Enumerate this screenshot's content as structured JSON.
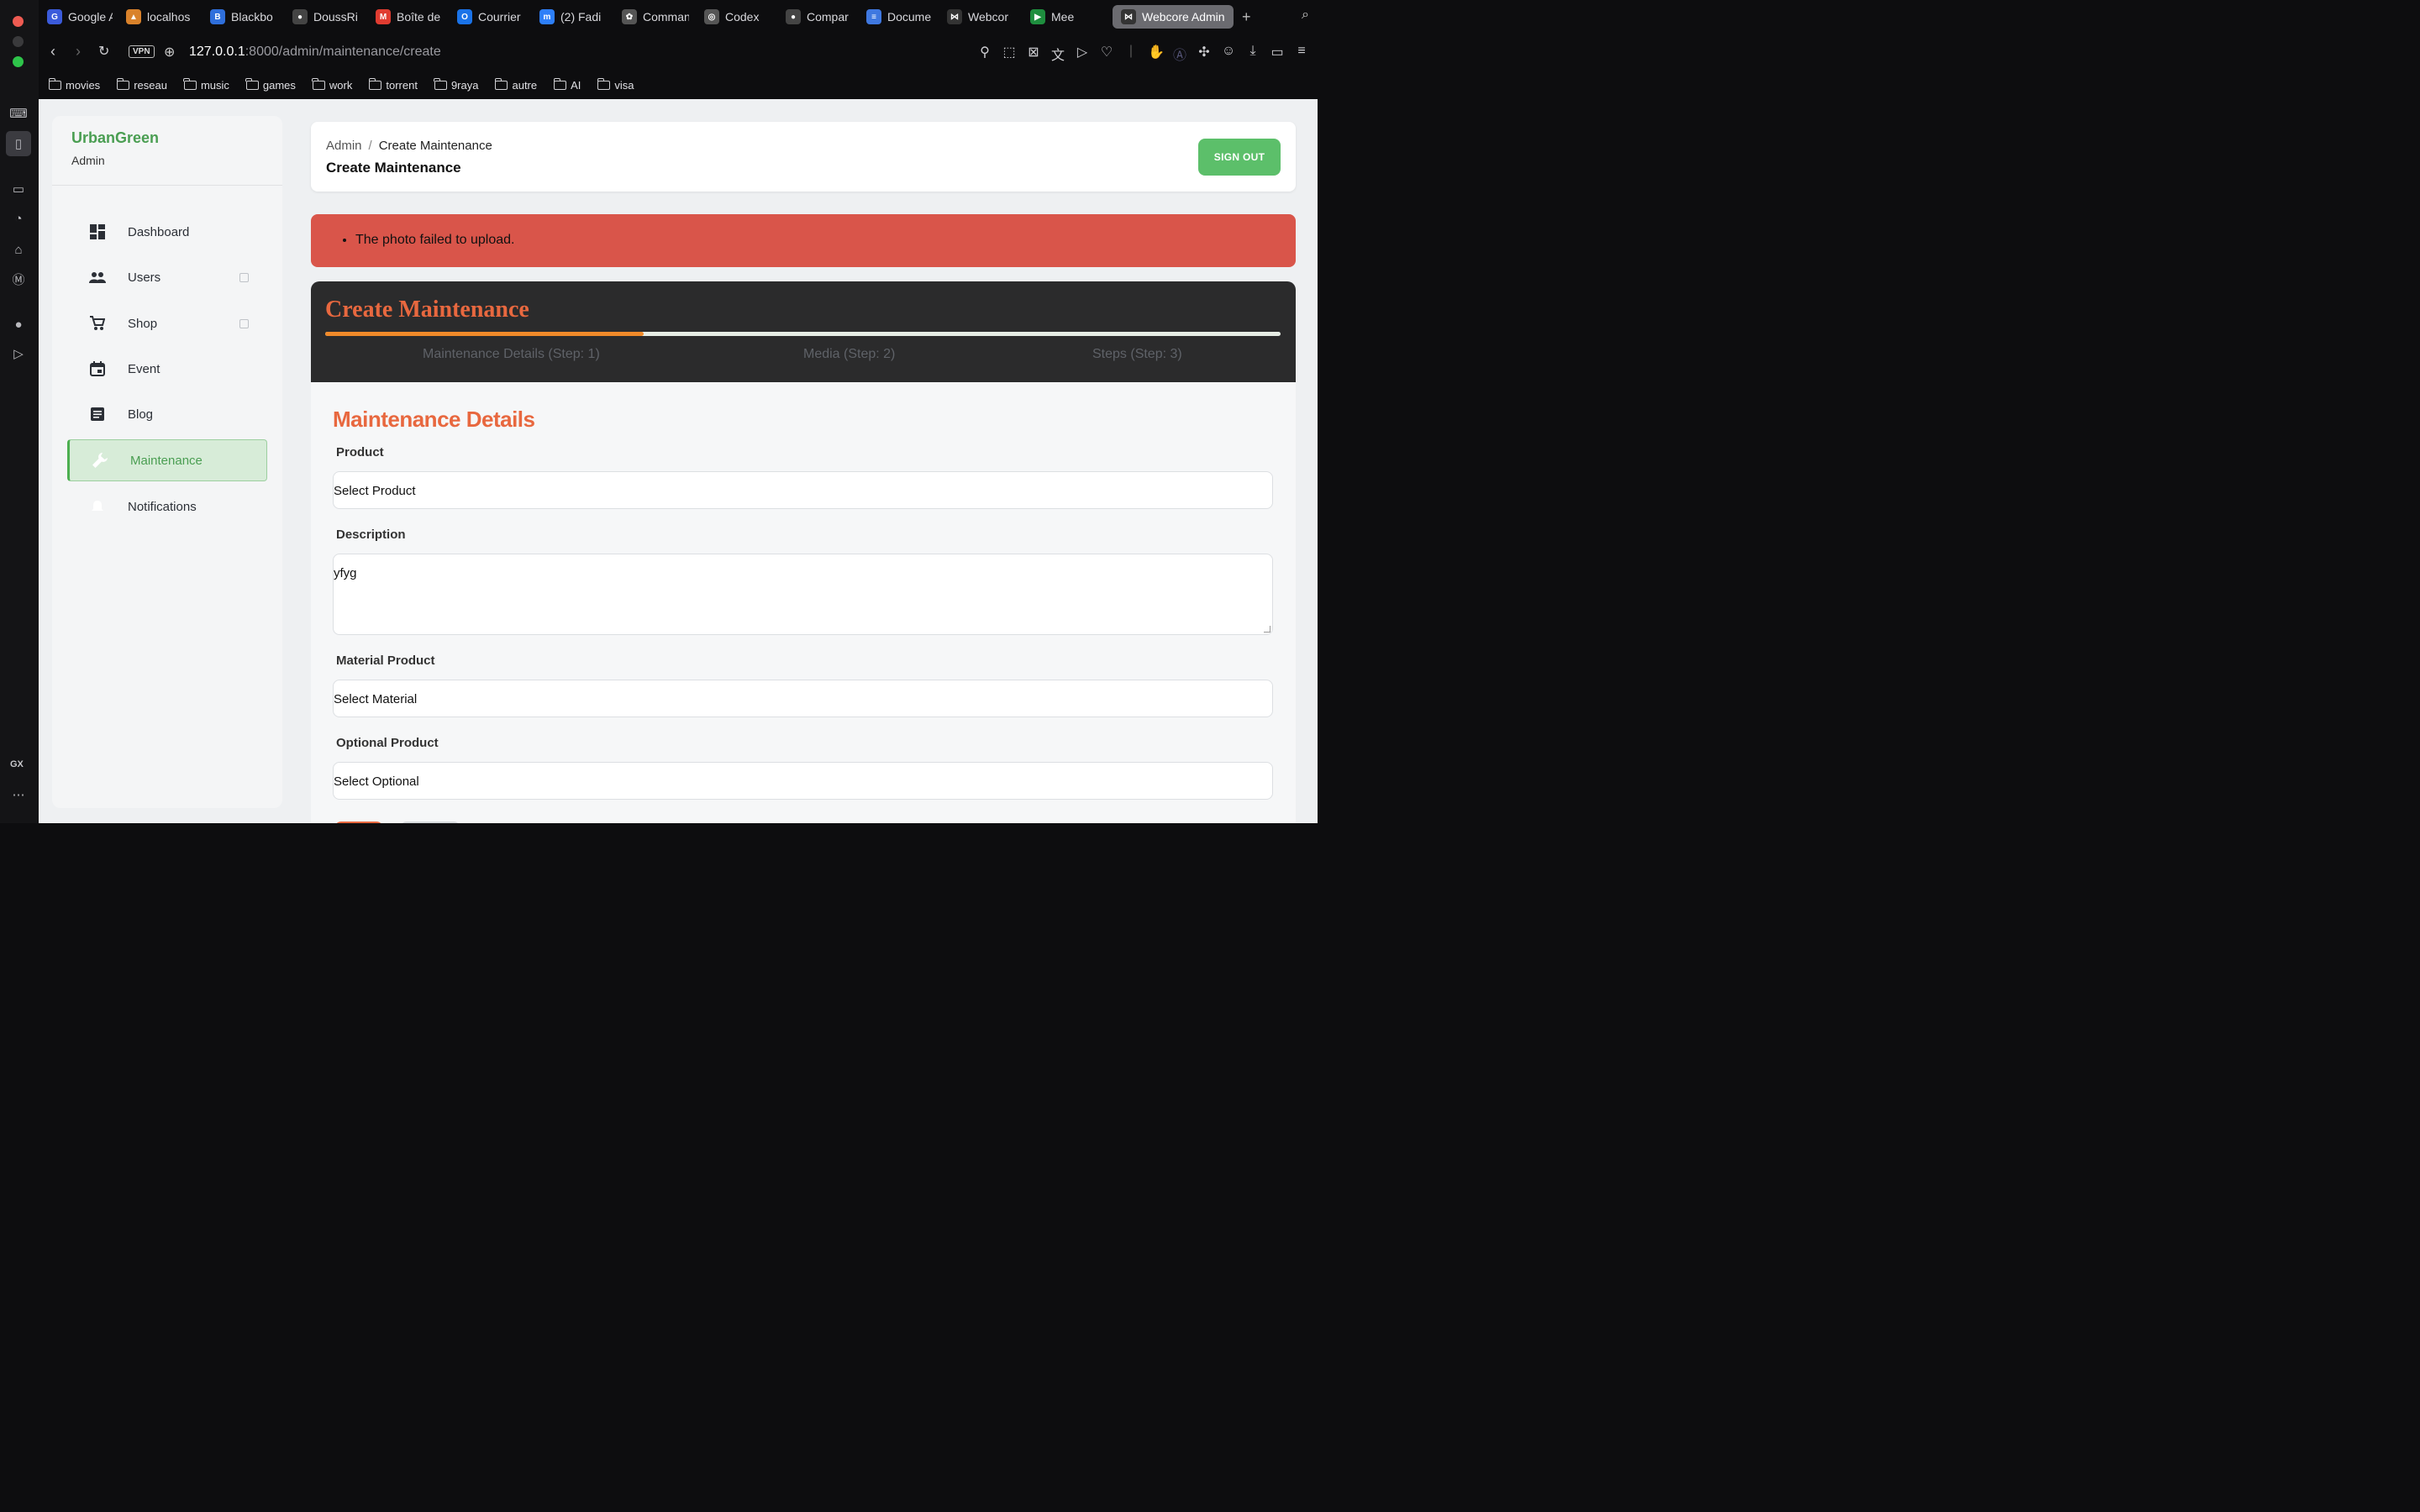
{
  "browser": {
    "tabs": [
      {
        "label": "Google A",
        "color": "#3b5bdb",
        "glyph": "G"
      },
      {
        "label": "localhos",
        "color": "#d9822b",
        "glyph": "▲"
      },
      {
        "label": "Blackbo",
        "color": "#2f6fdb",
        "glyph": "B"
      },
      {
        "label": "DoussRi",
        "color": "#444",
        "glyph": "●"
      },
      {
        "label": "Boîte de",
        "color": "#e03c31",
        "glyph": "M"
      },
      {
        "label": "Courrier",
        "color": "#1a73e8",
        "glyph": "O"
      },
      {
        "label": "(2) Fadi",
        "color": "#2d7ff9",
        "glyph": "m"
      },
      {
        "label": "Comman",
        "color": "#555",
        "glyph": "✿"
      },
      {
        "label": "Codex",
        "color": "#555",
        "glyph": "◎"
      },
      {
        "label": "Compar",
        "color": "#444",
        "glyph": "●"
      },
      {
        "label": "Docume",
        "color": "#3f78e0",
        "glyph": "≡"
      },
      {
        "label": "Webcor",
        "color": "#333",
        "glyph": "⋈"
      },
      {
        "label": "Mee",
        "color": "#1e8e3e",
        "glyph": "▶"
      },
      {
        "label": "Webcore Admin",
        "color": "#333",
        "glyph": "⋈"
      }
    ],
    "url_host": "127.0.0.1",
    "url_rest": ":8000/admin/maintenance/create",
    "vpn_label": "VPN",
    "bookmarks": [
      "movies",
      "reseau",
      "music",
      "games",
      "work",
      "torrent",
      "9raya",
      "autre",
      "AI",
      "visa"
    ],
    "gx_label": "GX"
  },
  "sidebar": {
    "brand": "UrbanGreen",
    "role": "Admin",
    "items": [
      {
        "label": "Dashboard",
        "icon": "dashboard-icon",
        "expandable": false
      },
      {
        "label": "Users",
        "icon": "users-icon",
        "expandable": true
      },
      {
        "label": "Shop",
        "icon": "cart-icon",
        "expandable": true
      },
      {
        "label": "Event",
        "icon": "calendar-icon",
        "expandable": false
      },
      {
        "label": "Blog",
        "icon": "article-icon",
        "expandable": false
      },
      {
        "label": "Maintenance",
        "icon": "wrench-icon",
        "expandable": false,
        "active": true
      },
      {
        "label": "Notifications",
        "icon": "bell-icon",
        "expandable": false
      }
    ]
  },
  "header": {
    "breadcrumb_root": "Admin",
    "breadcrumb_sep": "/",
    "breadcrumb_current": "Create Maintenance",
    "title": "Create Maintenance",
    "signout_label": "SIGN OUT"
  },
  "alert": {
    "messages": [
      "The photo failed to upload."
    ],
    "color": "#d9554a"
  },
  "form": {
    "title": "Create Maintenance",
    "progress_fraction": 0.333,
    "steps": [
      {
        "label": "Maintenance Details (Step: 1)",
        "current": true
      },
      {
        "label": "Media (Step: 2)",
        "current": false
      },
      {
        "label": "Steps (Step: 3)",
        "current": false
      }
    ],
    "section_title": "Maintenance Details",
    "fields": {
      "product": {
        "label": "Product",
        "value": "Select Product"
      },
      "description": {
        "label": "Description",
        "value": "yfyg"
      },
      "material": {
        "label": "Material Product",
        "value": "Select Material"
      },
      "optional": {
        "label": "Optional Product",
        "value": "Select Optional"
      }
    },
    "accent_color": "#e8683f",
    "step_color": "#f0902e"
  }
}
